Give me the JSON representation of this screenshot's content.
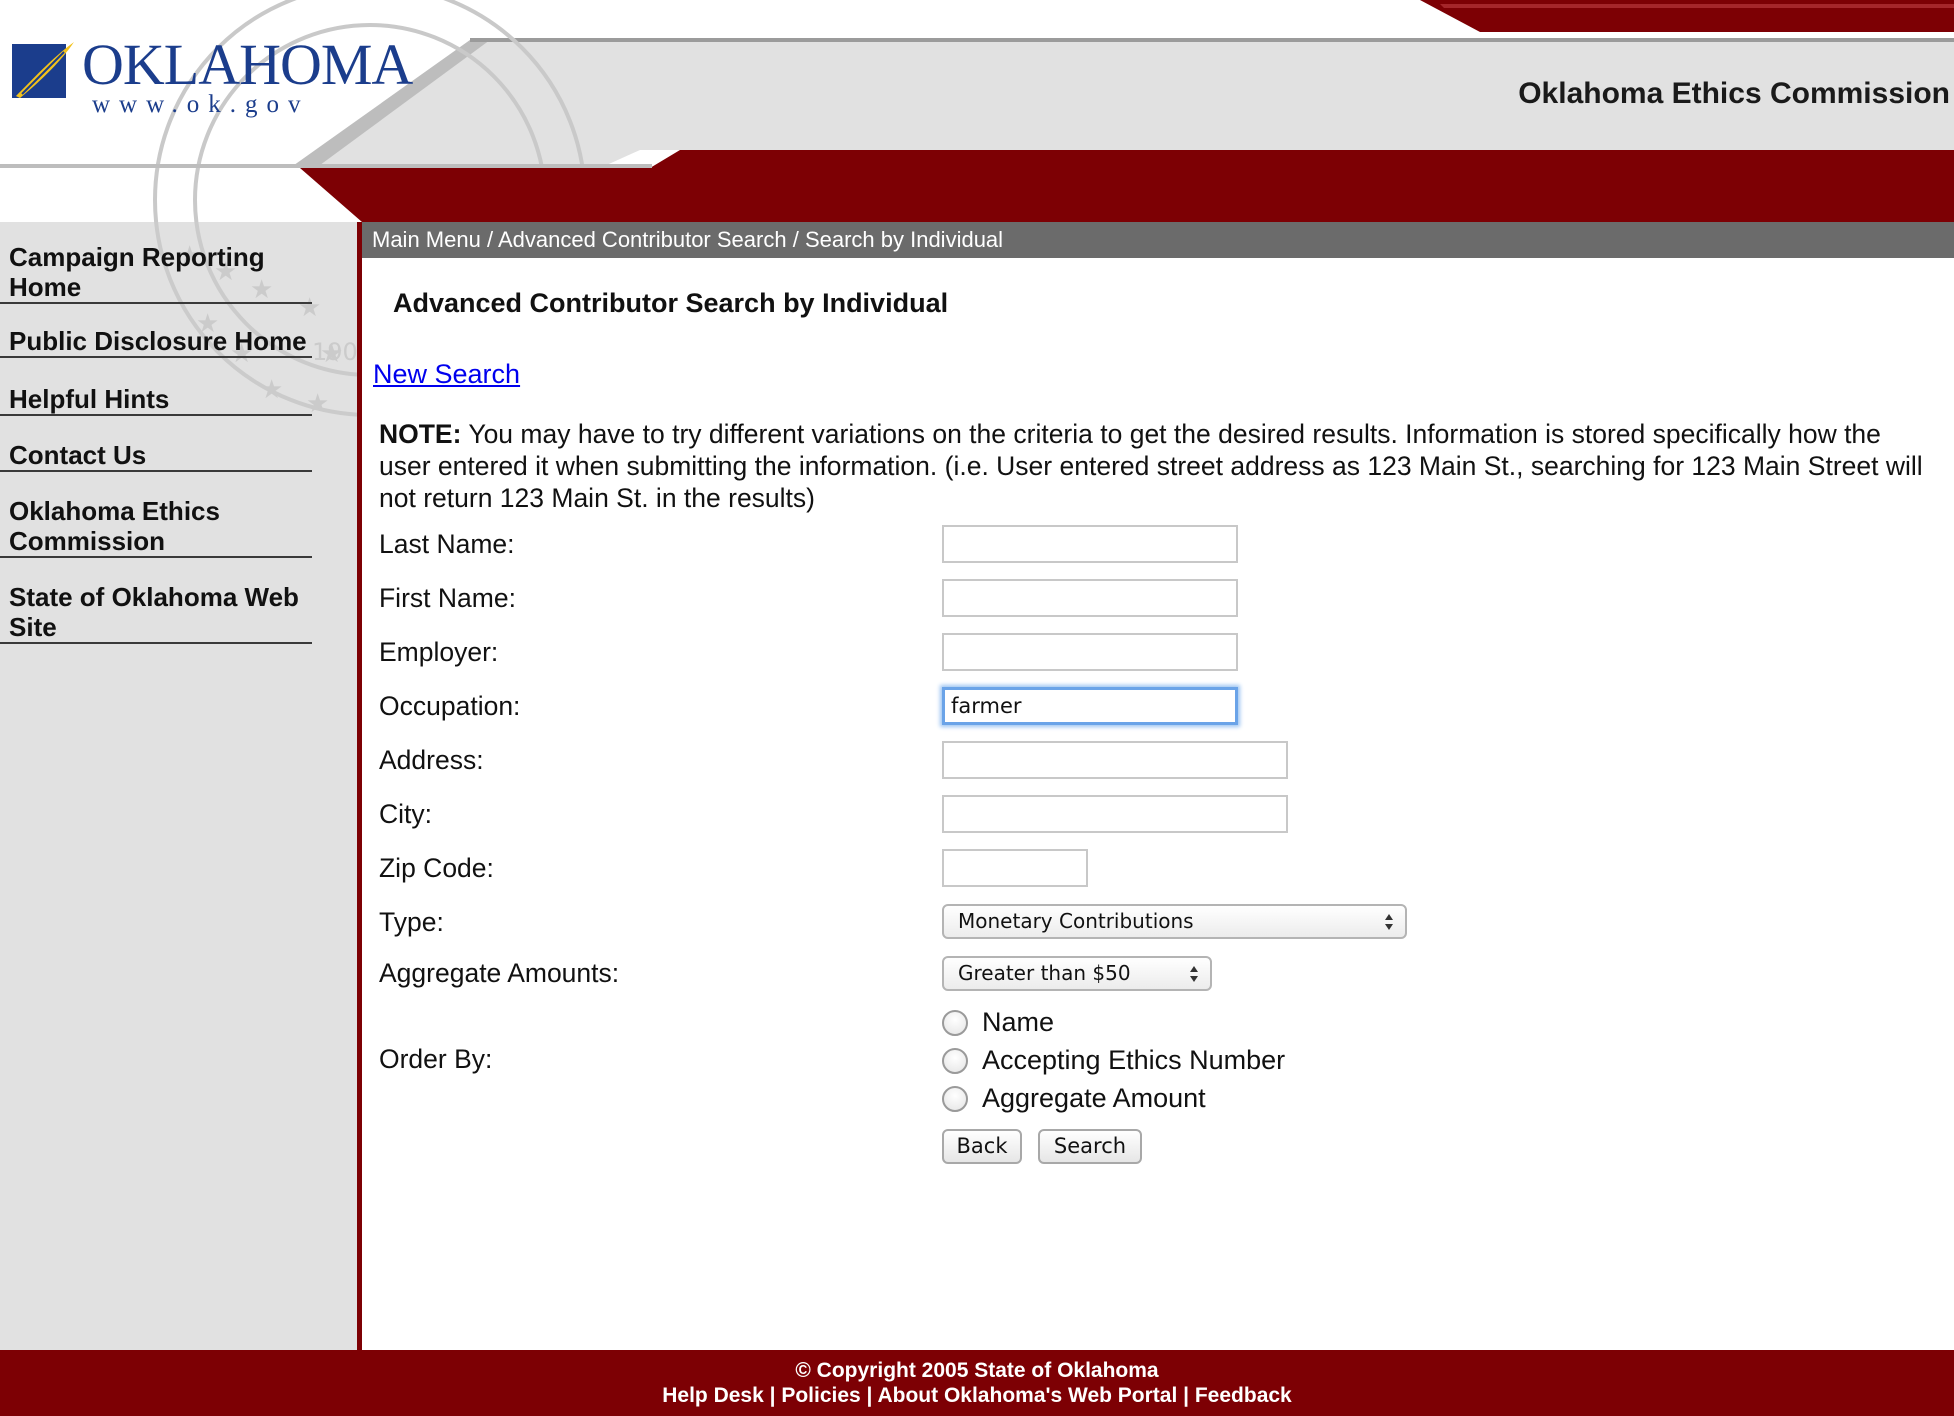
{
  "header": {
    "logo_word": "OKLAHOMA",
    "logo_url": "www.ok.gov",
    "site_title": "Oklahoma Ethics Commission",
    "brand_red": "#7d0004"
  },
  "sidebar": {
    "items": [
      {
        "label": "Campaign Reporting Home"
      },
      {
        "label": "Public Disclosure Home"
      },
      {
        "label": "Helpful Hints"
      },
      {
        "label": "Contact Us"
      },
      {
        "label": "Oklahoma Ethics Commission"
      },
      {
        "label": "State of Oklahoma Web Site"
      }
    ]
  },
  "breadcrumb": {
    "items": [
      "Main Menu",
      "Advanced Contributor Search",
      "Search by Individual"
    ],
    "separator": " / "
  },
  "main": {
    "heading": "Advanced Contributor Search by Individual",
    "new_search": "New Search",
    "note_label": "NOTE:",
    "note_text": " You may have to try different variations on the criteria to get the desired results. Information is stored specifically how the user entered it when submitting the information. (i.e. User entered street address as 123 Main St., searching for 123 Main Street will not return 123 Main St. in the results)"
  },
  "form": {
    "last_name": {
      "label": "Last Name:",
      "value": ""
    },
    "first_name": {
      "label": "First Name:",
      "value": ""
    },
    "employer": {
      "label": "Employer:",
      "value": ""
    },
    "occupation": {
      "label": "Occupation:",
      "value": "farmer"
    },
    "address": {
      "label": "Address:",
      "value": ""
    },
    "city": {
      "label": "City:",
      "value": ""
    },
    "zip_code": {
      "label": "Zip Code:",
      "value": ""
    },
    "type": {
      "label": "Type:",
      "selected": "Monetary Contributions"
    },
    "aggregate": {
      "label": "Aggregate Amounts:",
      "selected": "Greater than $50"
    },
    "order_by": {
      "label": "Order By:",
      "options": [
        "Name",
        "Accepting Ethics Number",
        "Aggregate Amount"
      ],
      "selected": null
    },
    "back_button": "Back",
    "search_button": "Search"
  },
  "footer": {
    "copyright": "© Copyright 2005 State of Oklahoma",
    "links": [
      "Help Desk",
      "Policies",
      "About Oklahoma's Web Portal",
      "Feedback"
    ],
    "separator": " | "
  }
}
